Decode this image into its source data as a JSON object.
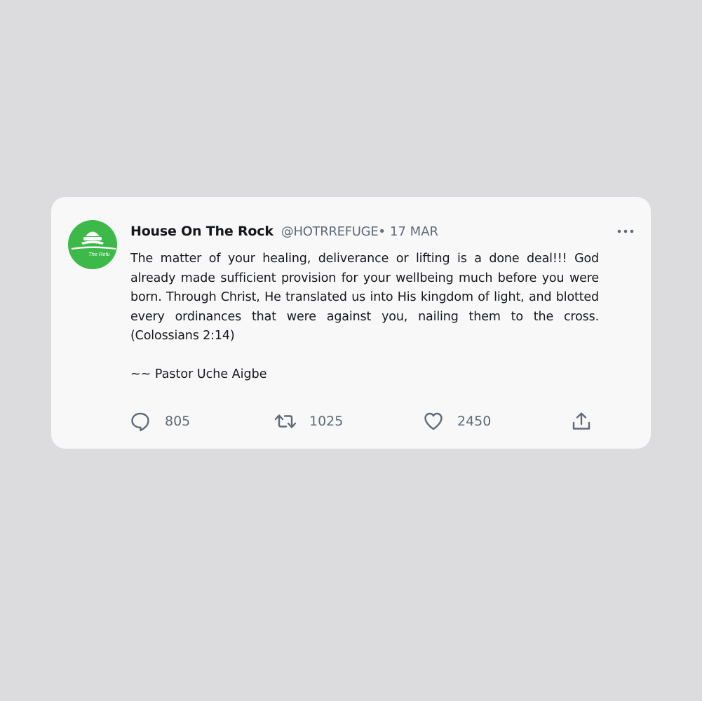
{
  "tweet": {
    "avatar_text": "The Refu",
    "display_name": "House On The Rock",
    "handle": "@HOTRREFUGE",
    "separator": "•",
    "date": "17 MAR",
    "body": "The matter of your healing, deliverance or lifting is a done deal!!! God already made sufficient provision for your wellbeing much before you were born. Through Christ, He translated us into His kingdom of light, and blotted every ordinances that were against you, nailing them to the cross. (Colossians 2:14)",
    "signature": "~~ Pastor Uche Aigbe"
  },
  "actions": {
    "reply_count": "805",
    "retweet_count": "1025",
    "like_count": "2450"
  },
  "icons": {
    "more": "more-horizontal-icon",
    "reply": "comment-bubble-icon",
    "retweet": "retweet-icon",
    "like": "heart-icon",
    "share": "share-upload-icon"
  },
  "colors": {
    "background": "#dcdcde",
    "card": "#f8f8f9",
    "avatar_green": "#3db94a",
    "text_primary": "#16181c",
    "text_secondary": "#5f6a78"
  }
}
